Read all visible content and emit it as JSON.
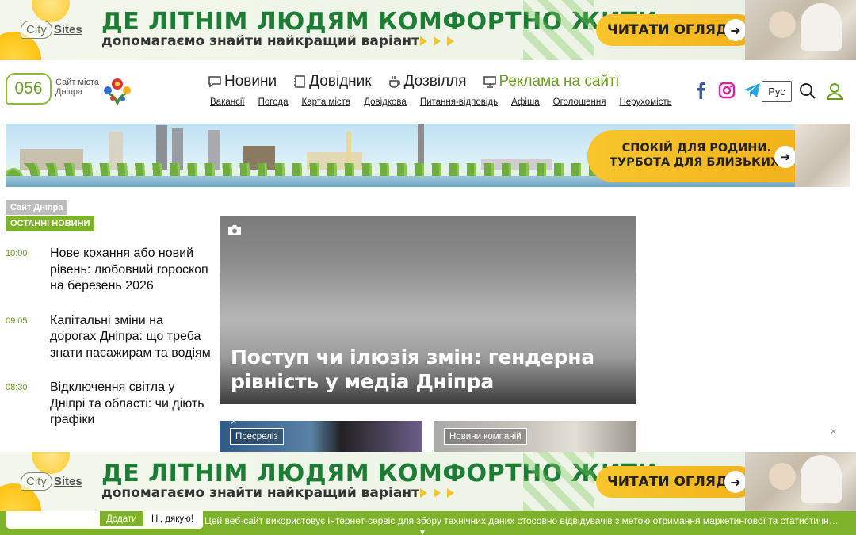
{
  "ad_top": {
    "logo_city": "City",
    "logo_sites": "Sites",
    "headline": "ДЕ ЛІТНІМ ЛЮДЯМ КОМФОРТНО ЖИТИ",
    "subline": "допомагаємо знайти найкращий варіант",
    "cta": "ЧИТАТИ ОГЛЯД",
    "cta_arrow": "➜"
  },
  "header": {
    "logo_number": "056",
    "logo_text": "Сайт міста Дніпра",
    "nav_main": [
      {
        "label": "Новини",
        "icon": "chat-icon"
      },
      {
        "label": "Довідник",
        "icon": "notebook-icon"
      },
      {
        "label": "Дозвілля",
        "icon": "coffee-icon"
      },
      {
        "label": "Реклама на сайті",
        "icon": "monitor-icon"
      }
    ],
    "nav_sub": [
      "Вакансії",
      "Погода",
      "Карта міста",
      "Довідкова",
      "Питання-відповідь",
      "Афіша",
      "Оголошення",
      "Нерухомість"
    ],
    "lang": "Рус",
    "colors": {
      "accent": "#7fb22b",
      "facebook": "#3b5998",
      "instagram": "#d6249f",
      "telegram": "#2ca5e0"
    }
  },
  "panorama_ad": {
    "line1": "СПОКІЙ ДЛЯ РОДИНИ.",
    "line2": "ТУРБОТА ДЛЯ БЛИЗЬКИХ.",
    "arrow": "➜"
  },
  "left_column": {
    "tag_site": "Сайт Дніпра",
    "tag_latest": "ОСТАННІ НОВИНИ",
    "news": [
      {
        "time": "10:00",
        "title": "Нове кохання або новий рівень: любовний гороскоп на березень 2026"
      },
      {
        "time": "09:05",
        "title": "Капітальні зміни на дорогах Дніпра: що треба знати пасажирам та водіям"
      },
      {
        "time": "08:30",
        "title": "Відключення світла у Дніпрі та області: чи діють графіки"
      }
    ]
  },
  "feature": {
    "title": "Поступ чи ілюзія змін: гендерна рівність у медіа Дніпра"
  },
  "cards": [
    {
      "badge": "Пресреліз"
    },
    {
      "badge": "Новини компаній"
    }
  ],
  "close_glyph": "×",
  "cookie": {
    "accept": "Додати",
    "decline": "Ні, дякую!",
    "message": "Цей веб-сайт використовує інтернет-сервіс для збору технічних даних стосовно відвідувачів з метою отримання маркетингової та статистичної інформації"
  }
}
